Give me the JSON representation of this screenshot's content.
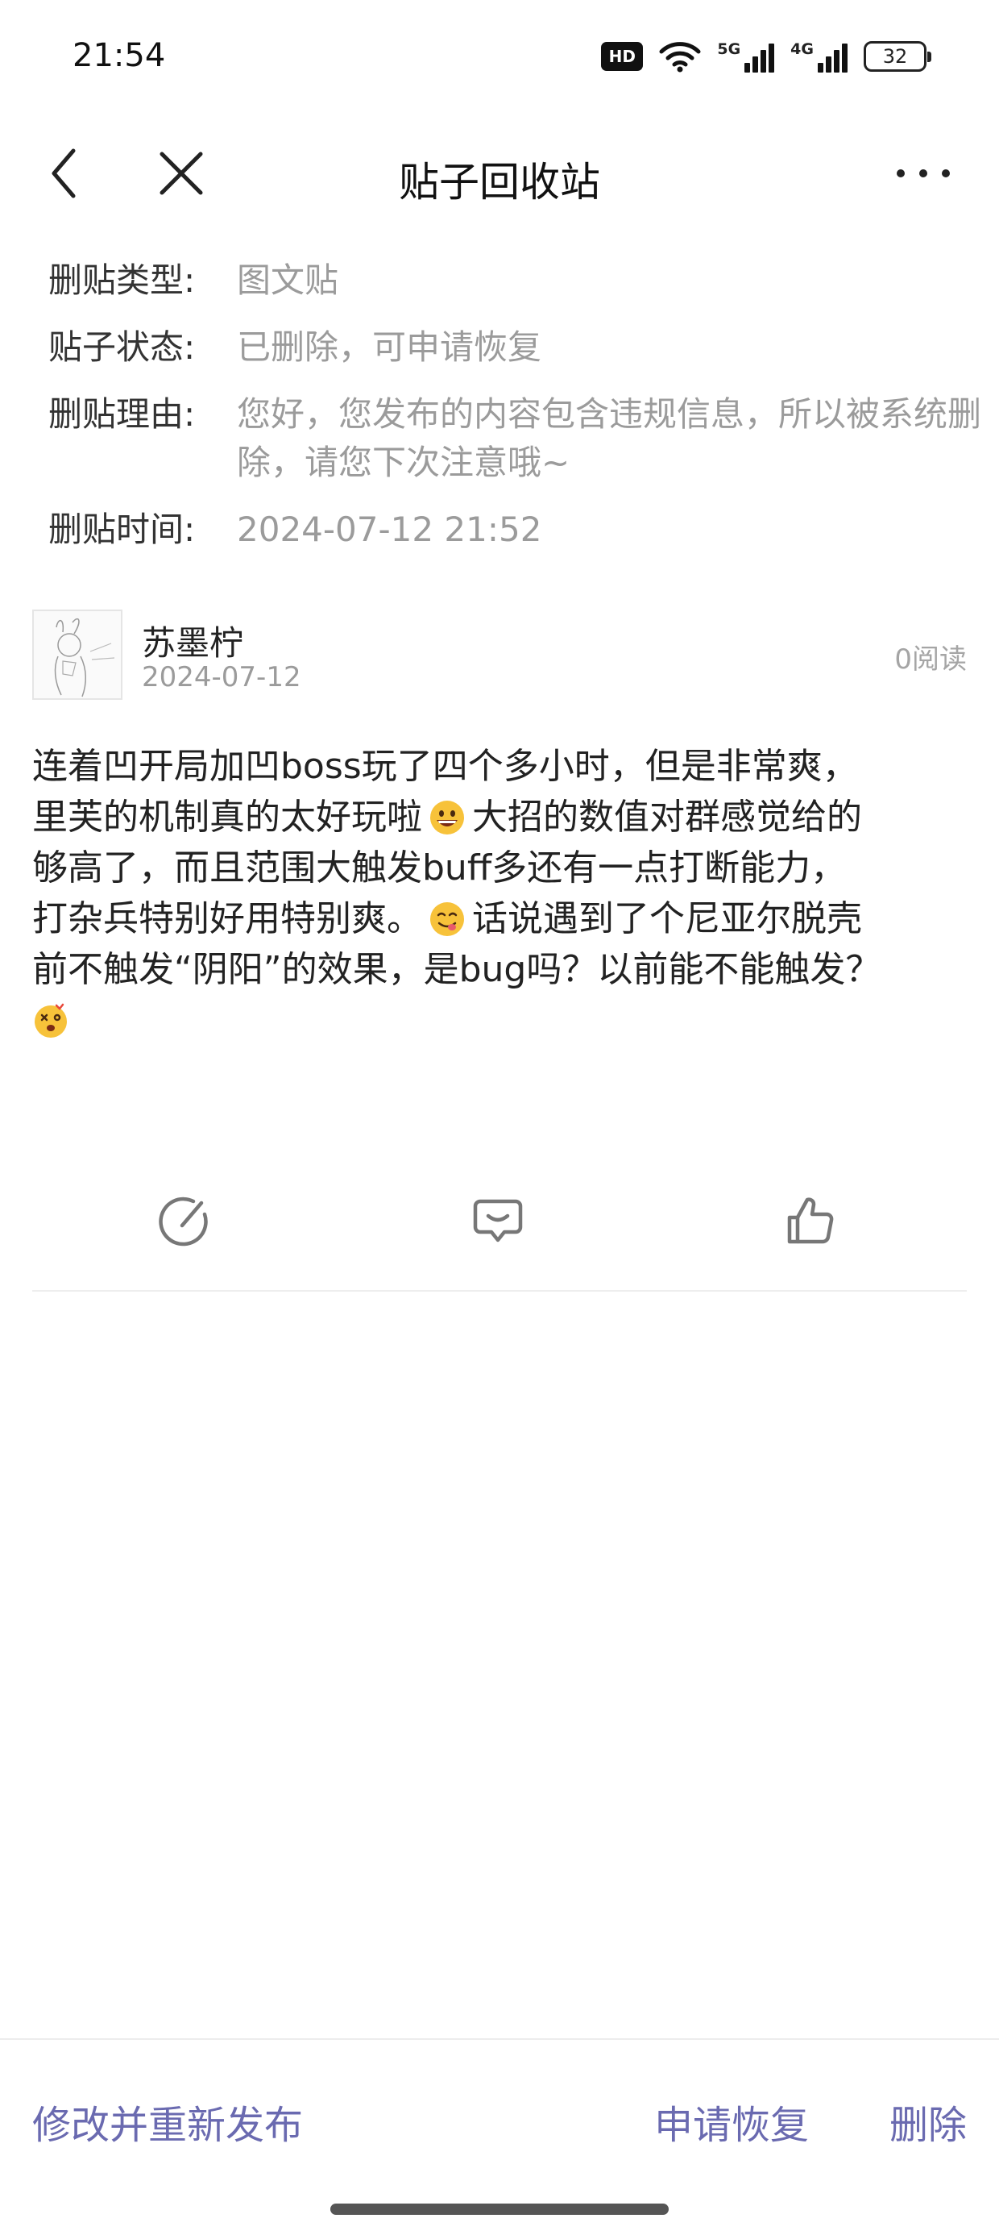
{
  "status_bar": {
    "time": "21:54",
    "hd_badge": "HD",
    "net_5g": "5G",
    "net_4g": "4G",
    "battery": "32",
    "icons": [
      "hd-voice-icon",
      "wifi-icon",
      "signal-5g-icon",
      "signal-4g-icon",
      "battery-icon"
    ]
  },
  "nav": {
    "title": "贴子回收站",
    "icons": [
      "back-icon",
      "close-icon",
      "more-icon"
    ]
  },
  "info": {
    "type_label": "删贴类型:",
    "type_value": "图文贴",
    "status_label": "贴子状态:",
    "status_value": "已删除，可申请恢复",
    "reason_label": "删贴理由:",
    "reason_value": "您好，您发布的内容包含违规信息，所以被系统删除，请您下次注意哦~",
    "time_label": "删贴时间:",
    "time_value": "2024-07-12 21:52"
  },
  "post": {
    "author": "苏墨柠",
    "date": "2024-07-12",
    "read_count": "0阅读",
    "content_lines": [
      "连着凹开局加凹boss玩了四个多小时，但是非常爽，",
      "里芙的机制真的太好玩啦",
      "大招的数值对群感觉给的",
      "够高了，而且范围大触发buff多还有一点打断能力，",
      "打杂兵特别好用特别爽。",
      "话说遇到了个尼亚尔脱壳",
      "前不触发“阴阳”的效果，是bug吗？以前能不能触发？"
    ],
    "emojis": [
      "grin-emoji",
      "yum-emoji",
      "dizzy-emoji"
    ]
  },
  "actions": {
    "icons": [
      "edit-icon",
      "comment-icon",
      "like-icon"
    ]
  },
  "bottom": {
    "edit_label": "修改并重新发布",
    "restore_label": "申请恢复",
    "delete_label": "删除"
  },
  "colors": {
    "accent": "#6a6ab0",
    "muted_text": "#9b9b9b",
    "text": "#222222"
  }
}
